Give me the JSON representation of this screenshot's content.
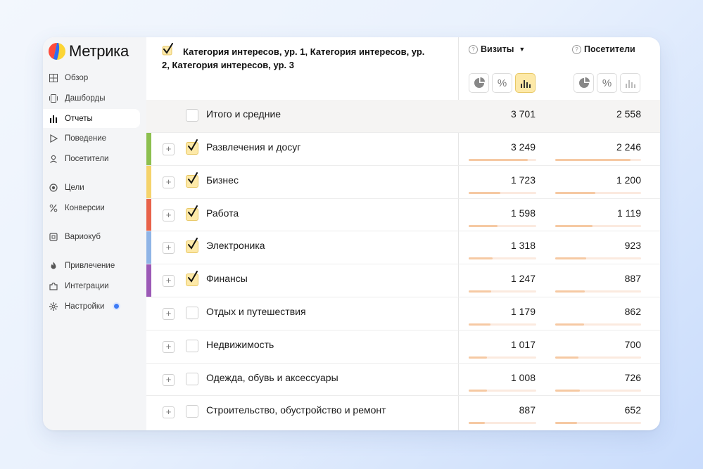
{
  "app": {
    "name": "Метрика",
    "brand_colors": {
      "yellow": "#fcd535",
      "red": "#ff4a3d",
      "blue": "#2f6cf5"
    }
  },
  "sidebar": {
    "items": [
      {
        "label": "Обзор",
        "icon": "grid-icon",
        "active": false
      },
      {
        "label": "Дашборды",
        "icon": "dashboards-icon",
        "active": false
      },
      {
        "label": "Отчеты",
        "icon": "bar-chart-icon",
        "active": true
      },
      {
        "label": "Поведение",
        "icon": "play-icon",
        "active": false
      },
      {
        "label": "Посетители",
        "icon": "person-icon",
        "active": false
      },
      {
        "label": "Цели",
        "icon": "target-icon",
        "active": false
      },
      {
        "label": "Конверсии",
        "icon": "percent-icon",
        "active": false
      },
      {
        "label": "Вариокуб",
        "icon": "cube-icon",
        "active": false
      },
      {
        "label": "Привлечение",
        "icon": "flame-icon",
        "active": false
      },
      {
        "label": "Интеграции",
        "icon": "puzzle-icon",
        "active": false
      },
      {
        "label": "Настройки",
        "icon": "gear-icon",
        "active": false,
        "badge": true
      }
    ]
  },
  "table": {
    "grouping_title": "Категория интересов, ур. 1, Категория интересов, ур. 2, Категория интересов, ур. 3",
    "columns": [
      {
        "label": "Визиты",
        "sorted": "desc",
        "sort_arrow": "▼"
      },
      {
        "label": "Посетители"
      }
    ],
    "total": {
      "label": "Итого и средние",
      "visits": "3 701",
      "visitors": "2 558"
    },
    "rows": [
      {
        "label": "Развлечения и досуг",
        "checked": true,
        "color": "#8cbf4f",
        "visits": "3 249",
        "visitors": "2 246",
        "visits_share": 0.878,
        "visitors_share": 0.878
      },
      {
        "label": "Бизнес",
        "checked": true,
        "color": "#f5d36b",
        "visits": "1 723",
        "visitors": "1 200",
        "visits_share": 0.466,
        "visitors_share": 0.469
      },
      {
        "label": "Работа",
        "checked": true,
        "color": "#e8624a",
        "visits": "1 598",
        "visitors": "1 119",
        "visits_share": 0.432,
        "visitors_share": 0.437
      },
      {
        "label": "Электроника",
        "checked": true,
        "color": "#8fb4e6",
        "visits": "1 318",
        "visitors": "923",
        "visits_share": 0.356,
        "visitors_share": 0.361
      },
      {
        "label": "Финансы",
        "checked": true,
        "color": "#9b59b6",
        "visits": "1 247",
        "visitors": "887",
        "visits_share": 0.337,
        "visitors_share": 0.347
      },
      {
        "label": "Отдых и путешествия",
        "checked": false,
        "color": "",
        "visits": "1 179",
        "visitors": "862",
        "visits_share": 0.319,
        "visitors_share": 0.337
      },
      {
        "label": "Недвижимость",
        "checked": false,
        "color": "",
        "visits": "1 017",
        "visitors": "700",
        "visits_share": 0.275,
        "visitors_share": 0.274
      },
      {
        "label": "Одежда, обувь и аксессуары",
        "checked": false,
        "color": "",
        "visits": "1 008",
        "visitors": "726",
        "visits_share": 0.272,
        "visitors_share": 0.284
      },
      {
        "label": "Строительство, обустройство и ремонт",
        "checked": false,
        "color": "",
        "visits": "887",
        "visitors": "652",
        "visits_share": 0.24,
        "visitors_share": 0.255
      }
    ]
  },
  "bar_colors": {
    "fill": "#f6c9a3",
    "track": "#fbeadf"
  }
}
